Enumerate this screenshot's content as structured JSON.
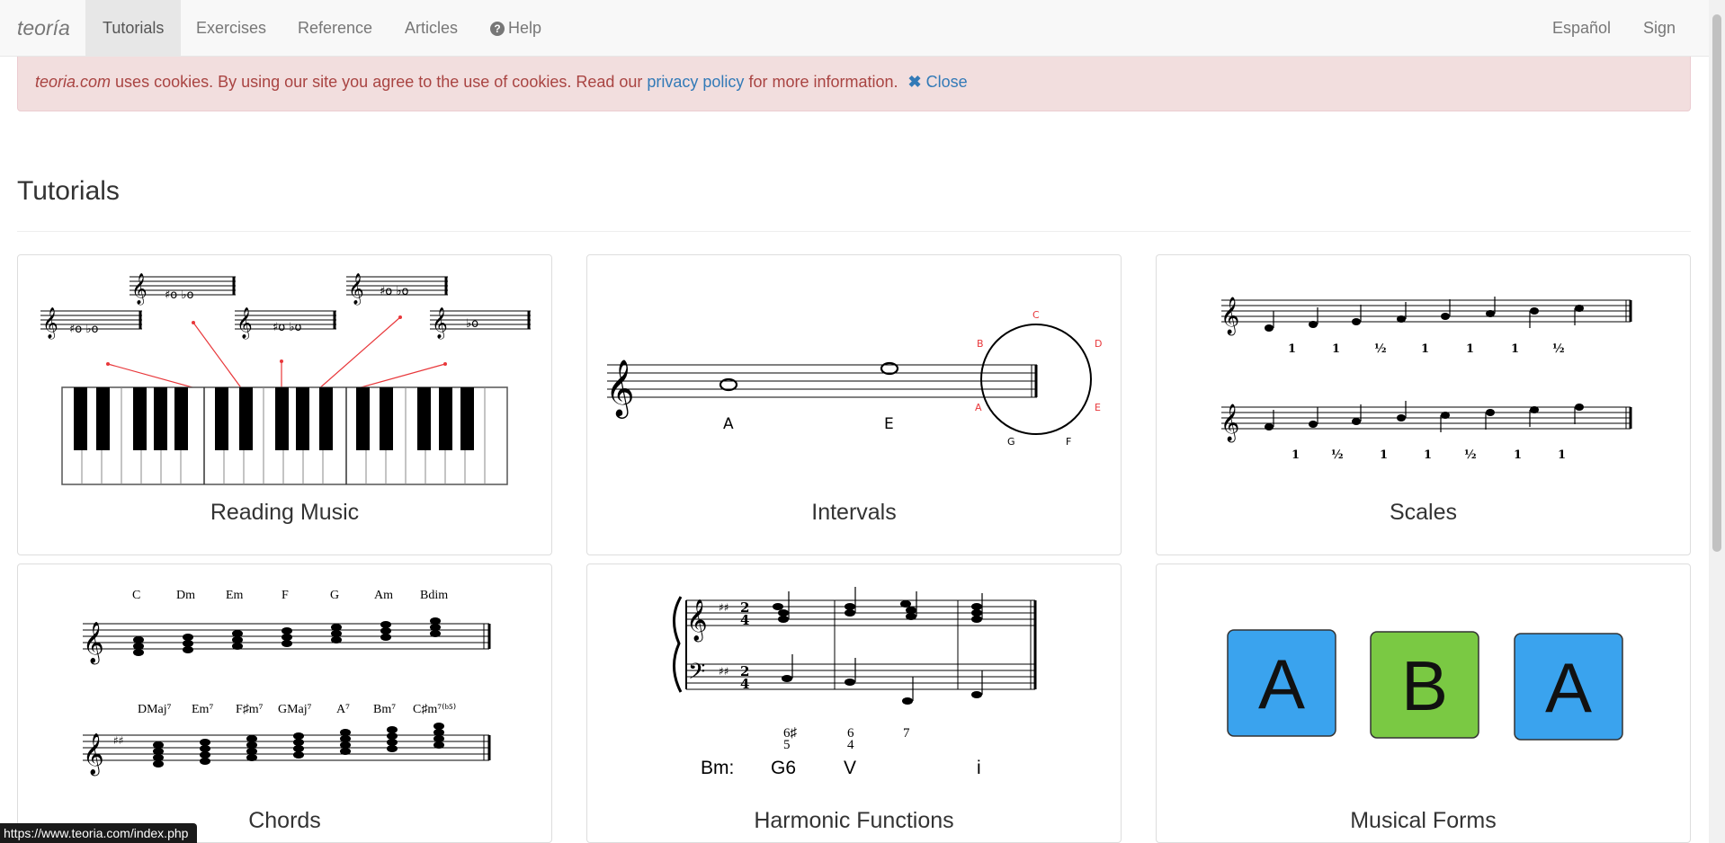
{
  "navbar": {
    "brand": "teoría",
    "items": [
      {
        "label": "Tutorials"
      },
      {
        "label": "Exercises"
      },
      {
        "label": "Reference"
      },
      {
        "label": "Articles"
      },
      {
        "label": "Help"
      }
    ],
    "language": "Español",
    "sign_in": "Sign in"
  },
  "cookie": {
    "site": "teoria.com",
    "text1": " uses cookies. By using our site you agree to the use of cookies. Read our ",
    "link": "privacy policy",
    "text2": " for more information. ",
    "close": "Close"
  },
  "page": {
    "title": "Tutorials"
  },
  "cards": [
    {
      "label": "Reading Music"
    },
    {
      "label": "Intervals",
      "notes": [
        "A",
        "E"
      ],
      "circle_letters": [
        "C",
        "D",
        "E",
        "F",
        "G",
        "A",
        "B"
      ]
    },
    {
      "label": "Scales",
      "row1_steps": [
        "1",
        "1",
        "½",
        "1",
        "1",
        "1",
        "½"
      ],
      "row2_steps": [
        "1",
        "½",
        "1",
        "1",
        "½",
        "1",
        "1"
      ]
    },
    {
      "label": "Chords",
      "row1_chords": [
        "C",
        "Dm",
        "Em",
        "F",
        "G",
        "Am",
        "Bdim"
      ],
      "row2_chords": [
        "DMaj⁷",
        "Em⁷",
        "F♯m⁷",
        "GMaj⁷",
        "A⁷",
        "Bm⁷",
        "C♯m⁷⁽ᵇ⁵⁾"
      ]
    },
    {
      "label": "Harmonic Functions",
      "key": "Bm:",
      "functions": [
        "G6",
        "V",
        "i"
      ],
      "figures": [
        "6♯",
        "5",
        "6",
        "4",
        "7"
      ]
    },
    {
      "label": "Musical Forms",
      "blocks": [
        "A",
        "B",
        "A"
      ]
    }
  ],
  "colors": {
    "block_blue": "#3aa3ee",
    "block_green": "#7ac943",
    "red_annotation": "#e8373a",
    "alert_bg": "#f2dede",
    "alert_text": "#a94442",
    "link": "#337ab7"
  },
  "status_bar": {
    "url": "https://www.teoria.com/index.php"
  }
}
